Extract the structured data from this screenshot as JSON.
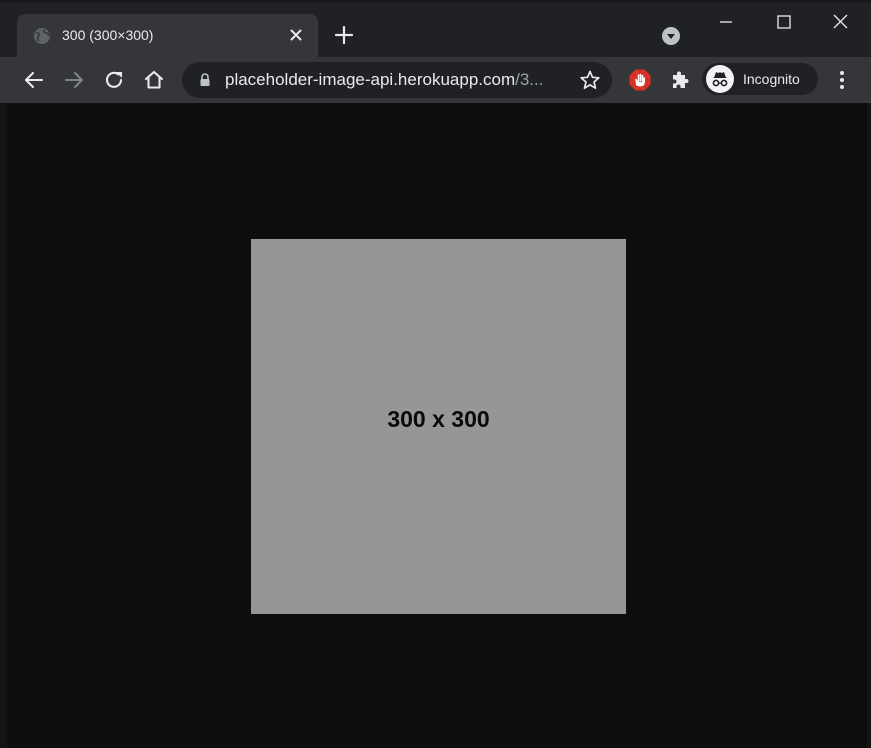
{
  "tab": {
    "title": "300 (300×300)",
    "favicon": "globe-icon"
  },
  "toolbar": {
    "url_host": "placeholder-image-api.herokuapp.com",
    "url_path": "/3...",
    "profile_label": "Incognito"
  },
  "page": {
    "image_text": "300 x 300"
  },
  "colors": {
    "tabstrip": "#202124",
    "toolbar": "#35363a",
    "content_bg": "#0e0e0e",
    "placeholder_bg": "#969696",
    "ext_red": "#d93025"
  },
  "icons": {
    "back": "arrow-left-icon",
    "forward": "arrow-right-icon",
    "reload": "reload-icon",
    "home": "home-icon",
    "lock": "lock-icon",
    "bookmark": "star-icon",
    "extension_blocker": "hand-stop-icon",
    "extensions": "puzzle-icon",
    "incognito": "incognito-icon",
    "menu": "kebab-menu-icon",
    "tab_search": "chevron-down-circle-icon",
    "new_tab": "plus-icon",
    "tab_close": "close-icon",
    "minimize": "minimize-icon",
    "maximize": "maximize-icon",
    "window_close": "close-icon"
  }
}
